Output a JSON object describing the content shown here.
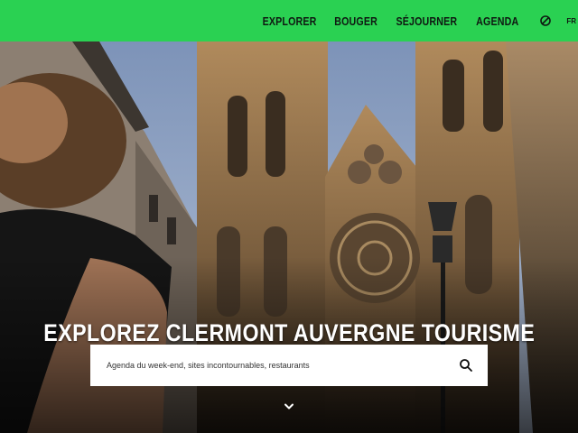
{
  "nav": {
    "items": [
      "EXPLORER",
      "BOUGER",
      "SÉJOURNER",
      "AGENDA"
    ],
    "icon": "leaf-icon",
    "lang_label": "FR"
  },
  "hero": {
    "headline": "EXPLOREZ CLERMONT AUVERGNE TOURISME",
    "search_placeholder": "Agenda du week-end, sites incontournables, restaurants",
    "search_icon": "search-icon",
    "scroll_icon": "chevron-down-icon"
  },
  "colors": {
    "brand_green": "#2ad152",
    "text_dark": "#0f1a12",
    "headline": "#ffffff"
  }
}
